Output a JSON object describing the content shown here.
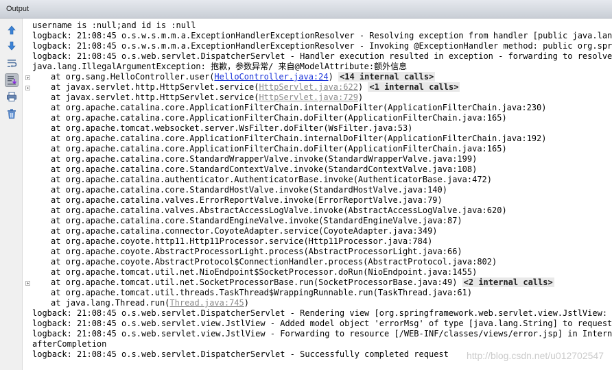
{
  "panel": {
    "title": "Output"
  },
  "icons": [
    "arrow-up-icon",
    "arrow-down-icon",
    "soft-wrap-icon",
    "scroll-to-end-icon",
    "print-icon",
    "trash-icon"
  ],
  "colors": {
    "link": "#1a33d9",
    "link_muted": "#8b8b8b",
    "fold_note_bg": "#e9e9e9"
  },
  "lines": [
    {
      "text": "username is :null;and id is :null"
    },
    {
      "text": "logback: 21:08:45 o.s.w.s.m.m.a.ExceptionHandlerExceptionResolver - Resolving exception from handler [public java.lang.St"
    },
    {
      "text": "logback: 21:08:45 o.s.w.s.m.m.a.ExceptionHandlerExceptionResolver - Invoking @ExceptionHandler method: public org.springf"
    },
    {
      "text": "logback: 21:08:45 o.s.web.servlet.DispatcherServlet - Handler execution resulted in exception - forwarding to resolved er"
    },
    {
      "text": "java.lang.IllegalArgumentException: 抱歉，参数异常/ 来自@ModelAttribute:额外信息"
    },
    {
      "indent": true,
      "fold": true,
      "text": "at org.sang.HelloController.user(",
      "link": "HelloController.java:24",
      "link_style": "blue",
      "after": ")",
      "note": "<14 internal calls>"
    },
    {
      "indent": true,
      "fold": true,
      "text": "at javax.servlet.http.HttpServlet.service(",
      "link": "HttpServlet.java:622",
      "link_style": "gray",
      "after": ")",
      "note": "<1 internal calls>"
    },
    {
      "indent": true,
      "text": "at javax.servlet.http.HttpServlet.service(",
      "link": "HttpServlet.java:729",
      "link_style": "gray",
      "after": ")"
    },
    {
      "indent": true,
      "text": "at org.apache.catalina.core.ApplicationFilterChain.internalDoFilter(ApplicationFilterChain.java:230)"
    },
    {
      "indent": true,
      "text": "at org.apache.catalina.core.ApplicationFilterChain.doFilter(ApplicationFilterChain.java:165)"
    },
    {
      "indent": true,
      "text": "at org.apache.tomcat.websocket.server.WsFilter.doFilter(WsFilter.java:53)"
    },
    {
      "indent": true,
      "text": "at org.apache.catalina.core.ApplicationFilterChain.internalDoFilter(ApplicationFilterChain.java:192)"
    },
    {
      "indent": true,
      "text": "at org.apache.catalina.core.ApplicationFilterChain.doFilter(ApplicationFilterChain.java:165)"
    },
    {
      "indent": true,
      "text": "at org.apache.catalina.core.StandardWrapperValve.invoke(StandardWrapperValve.java:199)"
    },
    {
      "indent": true,
      "text": "at org.apache.catalina.core.StandardContextValve.invoke(StandardContextValve.java:108)"
    },
    {
      "indent": true,
      "text": "at org.apache.catalina.authenticator.AuthenticatorBase.invoke(AuthenticatorBase.java:472)"
    },
    {
      "indent": true,
      "text": "at org.apache.catalina.core.StandardHostValve.invoke(StandardHostValve.java:140)"
    },
    {
      "indent": true,
      "text": "at org.apache.catalina.valves.ErrorReportValve.invoke(ErrorReportValve.java:79)"
    },
    {
      "indent": true,
      "text": "at org.apache.catalina.valves.AbstractAccessLogValve.invoke(AbstractAccessLogValve.java:620)"
    },
    {
      "indent": true,
      "text": "at org.apache.catalina.core.StandardEngineValve.invoke(StandardEngineValve.java:87)"
    },
    {
      "indent": true,
      "text": "at org.apache.catalina.connector.CoyoteAdapter.service(CoyoteAdapter.java:349)"
    },
    {
      "indent": true,
      "text": "at org.apache.coyote.http11.Http11Processor.service(Http11Processor.java:784)"
    },
    {
      "indent": true,
      "text": "at org.apache.coyote.AbstractProcessorLight.process(AbstractProcessorLight.java:66)"
    },
    {
      "indent": true,
      "text": "at org.apache.coyote.AbstractProtocol$ConnectionHandler.process(AbstractProtocol.java:802)"
    },
    {
      "indent": true,
      "text": "at org.apache.tomcat.util.net.NioEndpoint$SocketProcessor.doRun(NioEndpoint.java:1455)"
    },
    {
      "indent": true,
      "fold": true,
      "text": "at org.apache.tomcat.util.net.SocketProcessorBase.run(SocketProcessorBase.java:49)",
      "note": "<2 internal calls>"
    },
    {
      "indent": true,
      "text": "at org.apache.tomcat.util.threads.TaskThread$WrappingRunnable.run(TaskThread.java:61)"
    },
    {
      "indent": true,
      "text": "at java.lang.Thread.run(",
      "link": "Thread.java:745",
      "link_style": "gray",
      "after": ")"
    },
    {
      "text": "logback: 21:08:45 o.s.web.servlet.DispatcherServlet - Rendering view [org.springframework.web.servlet.view.JstlView: name"
    },
    {
      "text": "logback: 21:08:45 o.s.web.servlet.view.JstlView - Added model object 'errorMsg' of type [java.lang.String] to request in"
    },
    {
      "text": "logback: 21:08:45 o.s.web.servlet.view.JstlView - Forwarding to resource [/WEB-INF/classes/views/error.jsp] in InternalRe"
    },
    {
      "text": "afterCompletion"
    },
    {
      "text": "logback: 21:08:45 o.s.web.servlet.DispatcherServlet - Successfully completed request"
    }
  ],
  "watermark": "http://blog.csdn.net/u012702547"
}
